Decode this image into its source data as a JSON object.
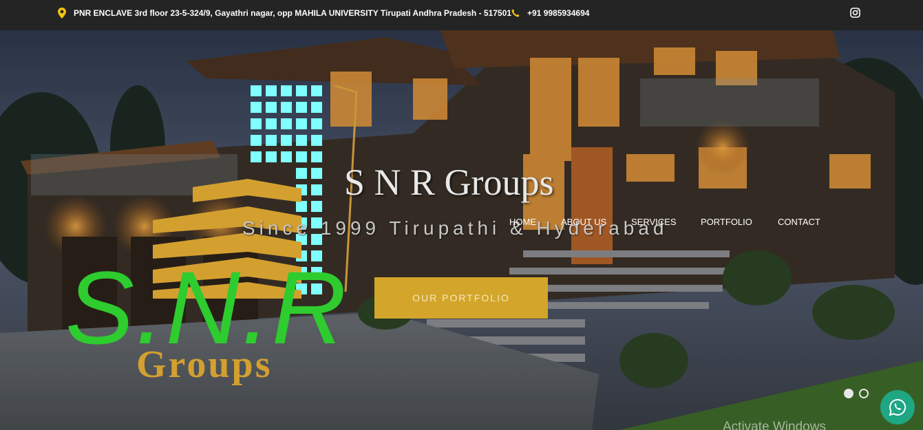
{
  "topbar": {
    "address": "PNR ENCLAVE 3rd floor 23-5-324/9, Gayathri nagar, opp MAHILA UNIVERSITY Tirupati Andhra Pradesh - 517501",
    "phone": "+91 9985934694",
    "icon_color": "#f1c40f"
  },
  "logo": {
    "mark_text": "S.N.R",
    "sub_text": "Groups",
    "green": "#2ecc2e",
    "gold": "#d3a030",
    "cyan": "#7fffff"
  },
  "hero": {
    "title": "S N R Groups",
    "subtitle": "Since 1999 Tirupathi & Hyderabad",
    "cta_label": "OUR PORTFOLIO",
    "cta_color": "#d3a52a"
  },
  "nav": {
    "items": [
      "HOME",
      "ABOUT US",
      "SERVICES",
      "PORTFOLIO",
      "CONTACT"
    ]
  },
  "slider": {
    "slides": 2,
    "active": 1
  },
  "system": {
    "watermark": "Activate Windows"
  }
}
